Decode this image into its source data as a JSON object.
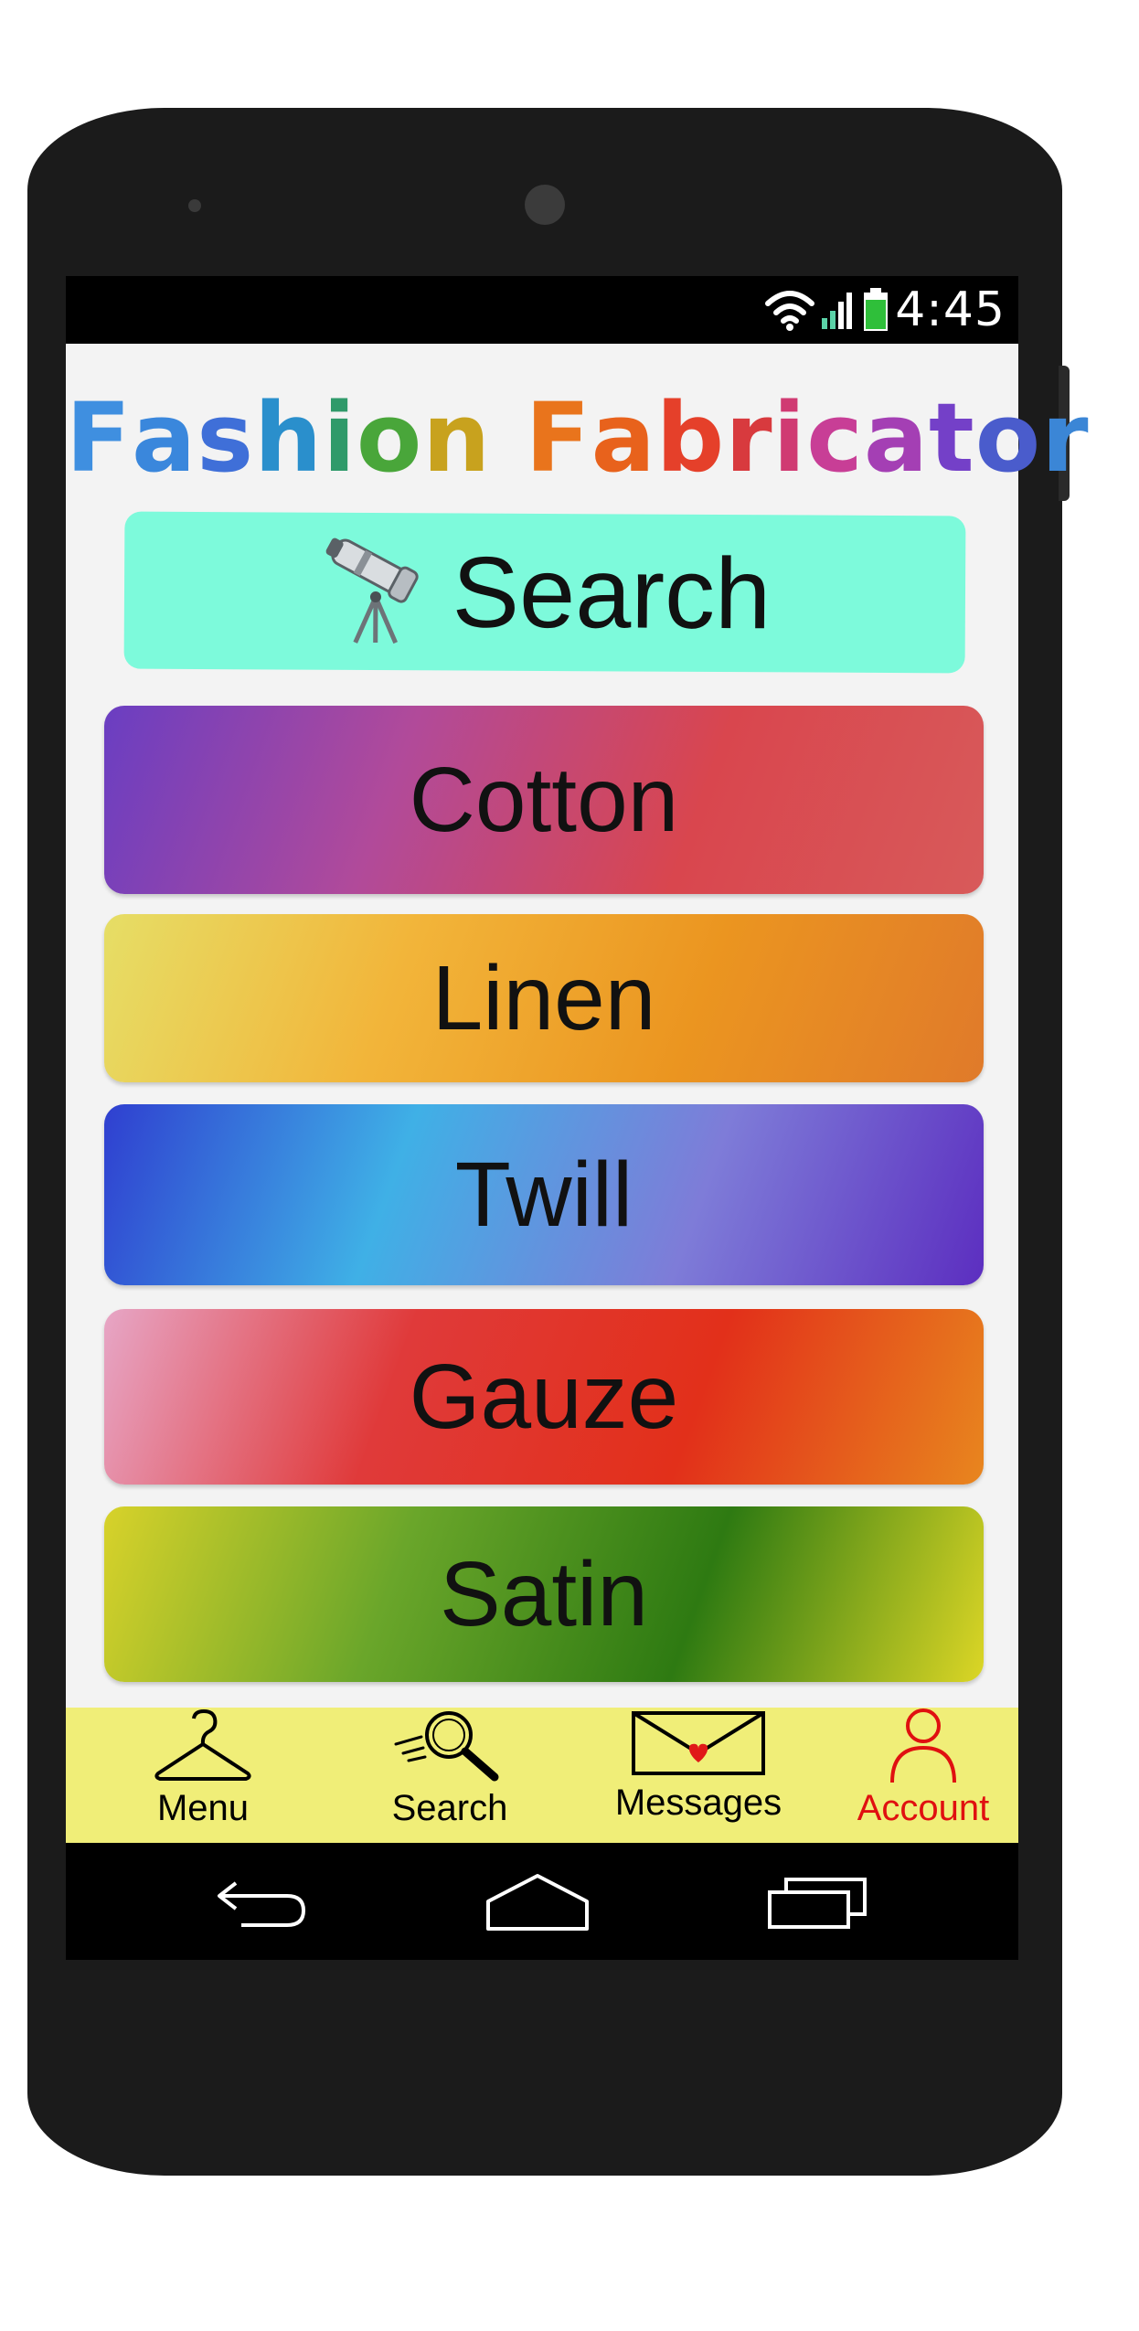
{
  "status_bar": {
    "time": "4:45"
  },
  "app": {
    "title_letters": [
      {
        "c": "F",
        "color": "#3f8fe0"
      },
      {
        "c": "a",
        "color": "#3a87dc"
      },
      {
        "c": "s",
        "color": "#3f6fd8"
      },
      {
        "c": "h",
        "color": "#2a8fcc"
      },
      {
        "c": "i",
        "color": "#2f9a6a"
      },
      {
        "c": "o",
        "color": "#49a63a"
      },
      {
        "c": "n",
        "color": "#c8a21e"
      },
      {
        "c": " ",
        "color": "#000000"
      },
      {
        "c": "F",
        "color": "#e9741c"
      },
      {
        "c": "a",
        "color": "#e8621c"
      },
      {
        "c": "b",
        "color": "#e5402a"
      },
      {
        "c": "r",
        "color": "#d83a3e"
      },
      {
        "c": "i",
        "color": "#d03a72"
      },
      {
        "c": "c",
        "color": "#c83e96"
      },
      {
        "c": "a",
        "color": "#a43fb4"
      },
      {
        "c": "t",
        "color": "#7440c8"
      },
      {
        "c": "o",
        "color": "#4a5ccc"
      },
      {
        "c": "r",
        "color": "#3b86d6"
      }
    ],
    "search": {
      "label": "Search",
      "icon": "telescope-icon",
      "bg": "#7dfadb"
    },
    "fabrics": [
      {
        "label": "Cotton",
        "gradient": [
          "#6a3ec2",
          "#b14a9a",
          "#d9464e",
          "#d85a5a"
        ]
      },
      {
        "label": "Linen",
        "gradient": [
          "#e6de66",
          "#f2b53a",
          "#eb9520",
          "#e07a2a"
        ]
      },
      {
        "label": "Twill",
        "gradient": [
          "#2f3fd0",
          "#3fb0e6",
          "#7e7cd8",
          "#5c2ec0"
        ]
      },
      {
        "label": "Gauze",
        "gradient": [
          "#e7a6c6",
          "#e03a3a",
          "#e2301a",
          "#e8861e"
        ]
      },
      {
        "label": "Satin",
        "gradient": [
          "#d8d22a",
          "#6aa62a",
          "#2e7a12",
          "#dcd626"
        ]
      }
    ]
  },
  "bottom_nav": [
    {
      "label": "Menu",
      "icon": "hanger-icon",
      "color": "#000000"
    },
    {
      "label": "Search",
      "icon": "search-magnifier-icon",
      "color": "#000000"
    },
    {
      "label": "Messages",
      "icon": "envelope-heart-icon",
      "color": "#000000"
    },
    {
      "label": "Account",
      "icon": "person-icon",
      "color": "#e01010"
    }
  ],
  "system_nav": [
    {
      "icon": "back-icon"
    },
    {
      "icon": "home-icon"
    },
    {
      "icon": "recent-apps-icon"
    }
  ]
}
